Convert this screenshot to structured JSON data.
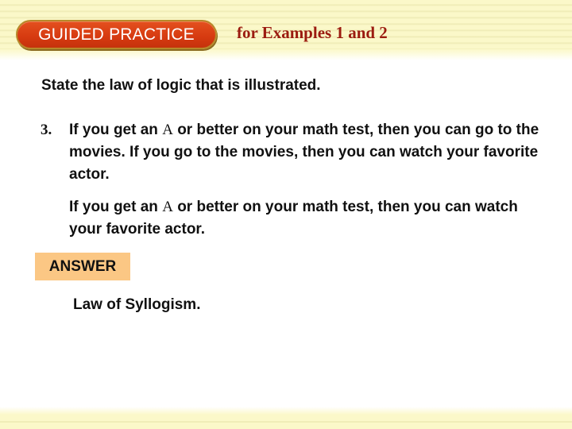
{
  "header": {
    "badge_label": "GUIDED PRACTICE",
    "subtitle": "for Examples 1 and 2"
  },
  "prompt": "State the law of logic that is illustrated.",
  "problem": {
    "number": "3.",
    "text_before_A": "If you get an ",
    "A": "A",
    "text_after_A": " or better on your math test, then you can go to the movies. If you go to the movies, then you can watch your favorite actor."
  },
  "conclusion": {
    "text_before_A": "If you get an ",
    "A": "A",
    "text_after_A": " or better on your math test, then you can watch your favorite actor."
  },
  "answer": {
    "label": "ANSWER",
    "text": "Law of Syllogism."
  },
  "colors": {
    "badge": "#d63a10",
    "subtitle": "#9b1b10",
    "answer_badge": "#fbc784",
    "band": "#fbf8c9"
  }
}
